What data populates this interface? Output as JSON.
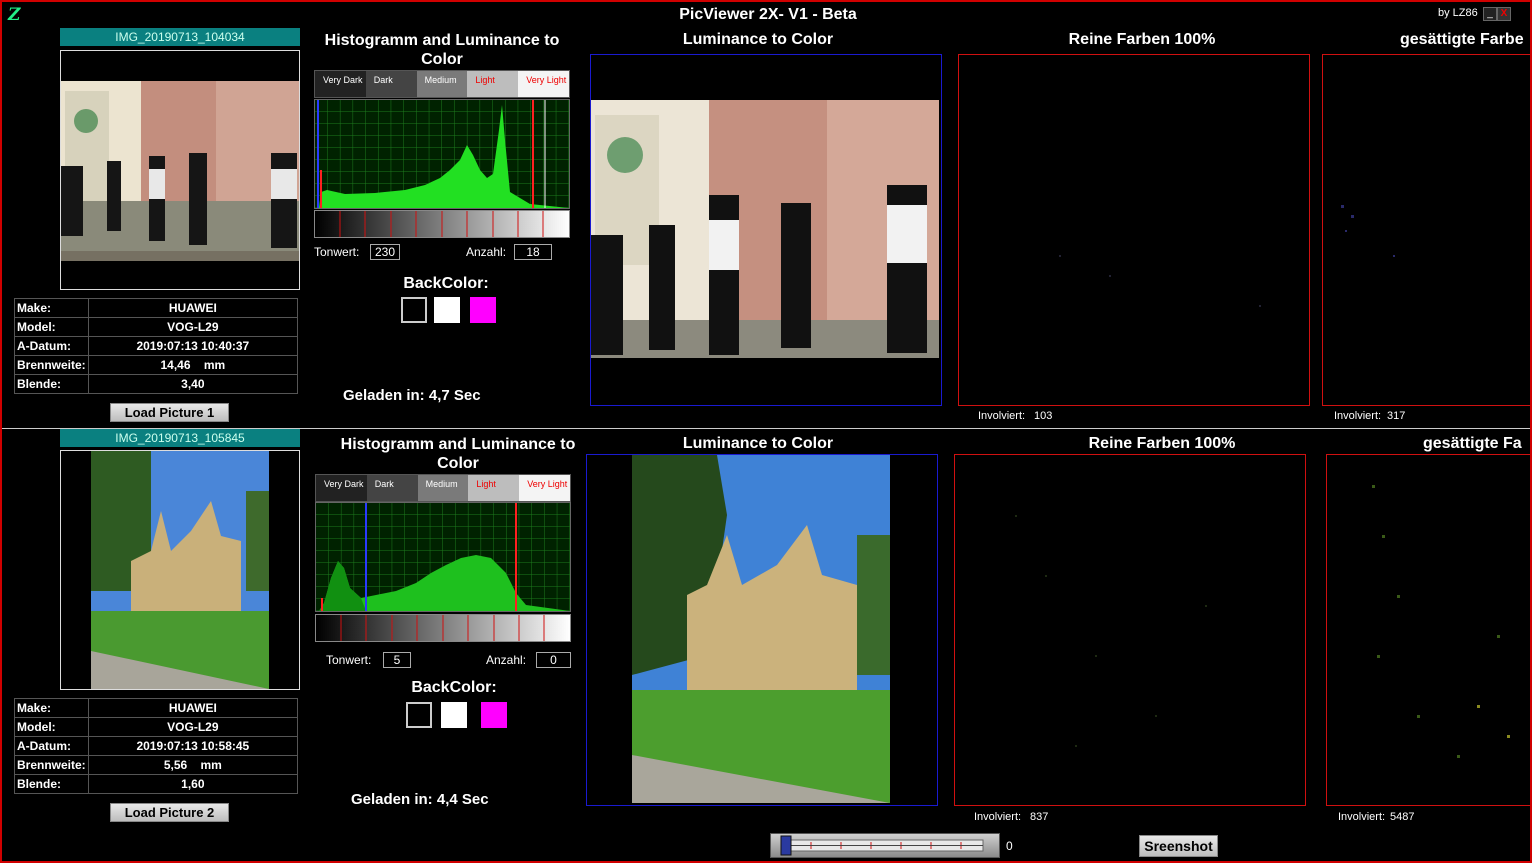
{
  "window": {
    "title": "PicViewer 2X- V1 - Beta",
    "by": "by LZ86",
    "minimize": "_",
    "close": "X",
    "logo": "Z"
  },
  "bands": [
    "Very Dark",
    "Dark",
    "Medium",
    "Light",
    "Very Light"
  ],
  "labels": {
    "tonwert": "Tonwert:",
    "anzahl": "Anzahl:",
    "backcolor": "BackColor:",
    "histogram_title": "Histogramm and Luminance to Color",
    "luminance": "Luminance to Color",
    "reine": "Reine Farben 100%",
    "gesaettigte_top": "gesättigte Farbe",
    "gesaettigte_bottom": "gesättigte Fa",
    "involviert": "Involviert:"
  },
  "meta_keys": {
    "make": "Make:",
    "model": "Model:",
    "datum": "A-Datum:",
    "brenn": "Brennweite:",
    "blende": "Blende:",
    "mm": "mm"
  },
  "picture1": {
    "name": "IMG_20190713_104034",
    "make": "HUAWEI",
    "model": "VOG-L29",
    "datum": "2019:07:13 10:40:37",
    "brennweite": "14,46",
    "blende": "3,40",
    "load_button": "Load Picture 1",
    "tonwert": "230",
    "anzahl": "18",
    "loaded": "Geladen in: 4,7 Sec",
    "involviert_reine": "103",
    "involviert_gesaettigt": "317"
  },
  "picture2": {
    "name": "IMG_20190713_105845",
    "make": "HUAWEI",
    "model": "VOG-L29",
    "datum": "2019:07:13 10:58:45",
    "brennweite": "5,56",
    "blende": "1,60",
    "load_button": "Load Picture 2",
    "tonwert": "5",
    "anzahl": "0",
    "loaded": "Geladen in: 4,4 Sec",
    "involviert_reine": "837",
    "involviert_gesaettigt": "5487"
  },
  "bottom": {
    "slider_value": "0",
    "screenshot_button": "Sreenshot"
  },
  "colors": {
    "backcolor_swatches": [
      "#000000",
      "#ffffff",
      "#ff00ff"
    ],
    "title_bar_accent": "#d00000",
    "panel_border_blue": "#1a1ad0",
    "panel_border_red": "#d01010",
    "name_bar": "#0a8080"
  }
}
